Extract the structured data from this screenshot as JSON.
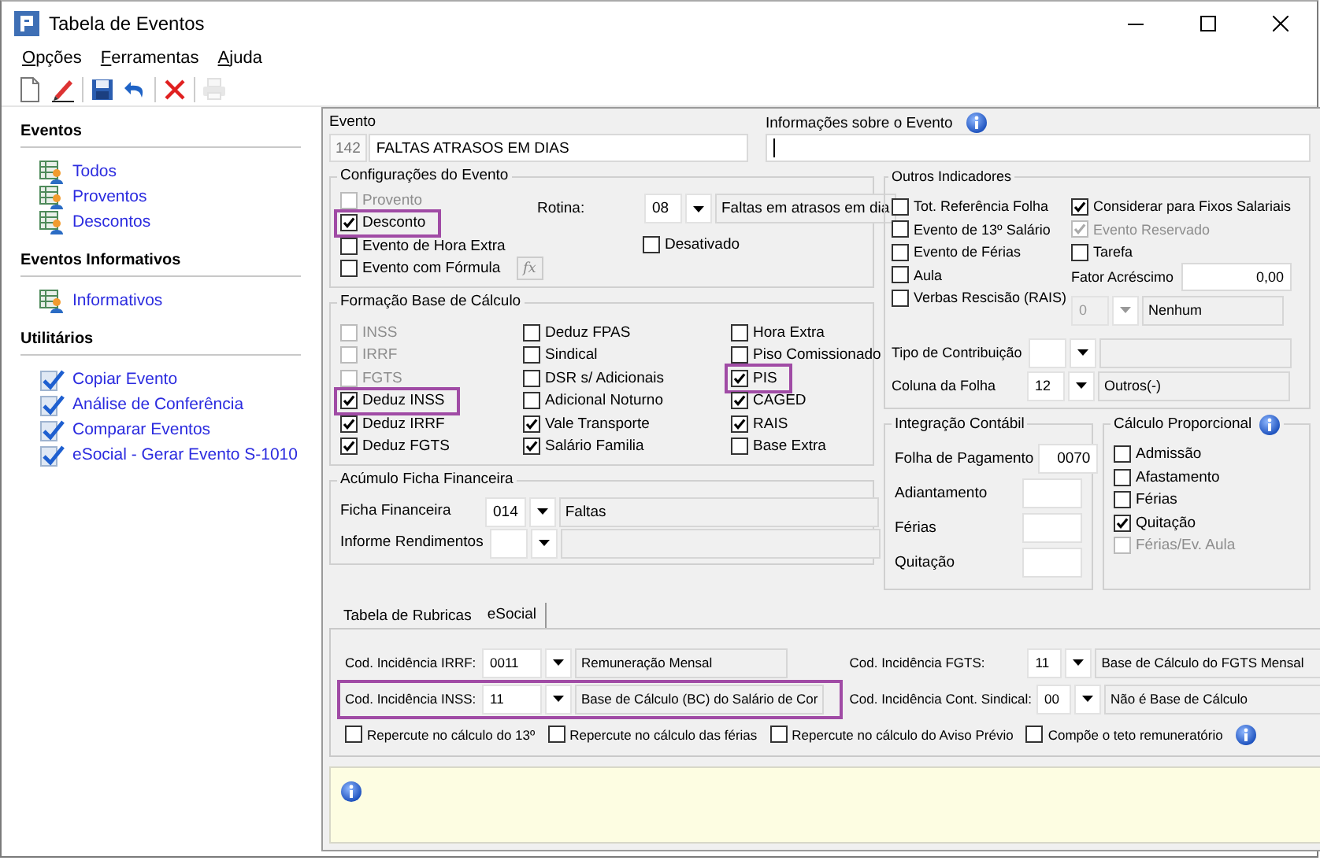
{
  "window": {
    "title": "Tabela de Eventos"
  },
  "menu": [
    {
      "label": "Opções"
    },
    {
      "label": "Ferramentas"
    },
    {
      "label": "Ajuda"
    }
  ],
  "toolbar": [
    {
      "kind": "new",
      "disabled": false
    },
    {
      "kind": "edit",
      "disabled": false
    },
    {
      "kind": "separator"
    },
    {
      "kind": "save",
      "disabled": false
    },
    {
      "kind": "undo",
      "disabled": false
    },
    {
      "kind": "separator"
    },
    {
      "kind": "delete",
      "disabled": false
    },
    {
      "kind": "separator"
    },
    {
      "kind": "print",
      "disabled": true
    }
  ],
  "sidebar": [
    {
      "title": "Eventos",
      "items": [
        {
          "label": "Todos",
          "kind": "list"
        },
        {
          "label": "Proventos",
          "kind": "list"
        },
        {
          "label": "Descontos",
          "kind": "list"
        }
      ]
    },
    {
      "title": "Eventos Informativos",
      "items": [
        {
          "label": "Informativos",
          "kind": "list"
        }
      ]
    },
    {
      "title": "Utilitários",
      "items": [
        {
          "label": "Copiar Evento",
          "kind": "tool"
        },
        {
          "label": "Análise de Conferência",
          "kind": "tool"
        },
        {
          "label": "Comparar Eventos",
          "kind": "tool"
        },
        {
          "label": "eSocial - Gerar Evento S-1010",
          "kind": "tool"
        }
      ]
    }
  ],
  "evento": {
    "label": "Evento",
    "code": "142",
    "name": "FALTAS ATRASOS EM DIAS"
  },
  "informacoes": {
    "label": "Informações sobre o Evento"
  },
  "configuracoes": {
    "title": "Configurações do Evento",
    "checkboxes": [
      {
        "label": "Provento",
        "checked": false,
        "disabled": true,
        "highlighted": false
      },
      {
        "label": "Desconto",
        "checked": true,
        "disabled": false,
        "highlighted": true
      },
      {
        "label": "Evento de Hora Extra",
        "checked": false,
        "disabled": false,
        "highlighted": false
      },
      {
        "label": "Evento com Fórmula",
        "checked": false,
        "disabled": false,
        "highlighted": false,
        "button": "fx"
      }
    ],
    "rotina": {
      "label": "Rotina:",
      "code": "08",
      "description": "Faltas em atrasos em dia"
    },
    "desativado": {
      "label": "Desativado",
      "checked": false
    }
  },
  "formacao": {
    "title": "Formação Base de Cálculo",
    "checkboxes": [
      {
        "label": "INSS",
        "checked": false,
        "disabled": true,
        "highlighted": false
      },
      {
        "label": "IRRF",
        "checked": false,
        "disabled": true,
        "highlighted": false
      },
      {
        "label": "FGTS",
        "checked": false,
        "disabled": true,
        "highlighted": false
      },
      {
        "label": "Deduz INSS",
        "checked": true,
        "disabled": false,
        "highlighted": true
      },
      {
        "label": "Deduz IRRF",
        "checked": true,
        "disabled": false,
        "highlighted": false
      },
      {
        "label": "Deduz FGTS",
        "checked": true,
        "disabled": false,
        "highlighted": false
      },
      {
        "label": "Deduz FPAS",
        "checked": false,
        "disabled": false,
        "highlighted": false
      },
      {
        "label": "Sindical",
        "checked": false,
        "disabled": false,
        "highlighted": false
      },
      {
        "label": "DSR s/ Adicionais",
        "checked": false,
        "disabled": false,
        "highlighted": false
      },
      {
        "label": "Adicional Noturno",
        "checked": false,
        "disabled": false,
        "highlighted": false
      },
      {
        "label": "Vale Transporte",
        "checked": true,
        "disabled": false,
        "highlighted": false
      },
      {
        "label": "Salário Familia",
        "checked": true,
        "disabled": false,
        "highlighted": false
      },
      {
        "label": "Hora Extra",
        "checked": false,
        "disabled": false,
        "highlighted": false
      },
      {
        "label": "Piso Comissionado",
        "checked": false,
        "disabled": false,
        "highlighted": false
      },
      {
        "label": "PIS",
        "checked": true,
        "disabled": false,
        "highlighted": true
      },
      {
        "label": "CAGED",
        "checked": true,
        "disabled": false,
        "highlighted": false
      },
      {
        "label": "RAIS",
        "checked": true,
        "disabled": false,
        "highlighted": false
      },
      {
        "label": "Base Extra",
        "checked": false,
        "disabled": false,
        "highlighted": false
      }
    ]
  },
  "acumulo": {
    "title": "Acúmulo Ficha Financeira",
    "rows": [
      {
        "label": "Ficha Financeira",
        "code": "014",
        "description": "Faltas"
      },
      {
        "label": "Informe Rendimentos"
      }
    ]
  },
  "outros": {
    "title": "Outros Indicadores",
    "left": [
      {
        "label": "Tot. Referência Folha",
        "checked": false
      },
      {
        "label": "Evento de 13º Salário",
        "checked": false
      },
      {
        "label": "Evento de Férias",
        "checked": false
      },
      {
        "label": "Aula",
        "checked": false
      },
      {
        "label": "Verbas Rescisão (RAIS)",
        "checked": false
      }
    ],
    "right": [
      {
        "label": "Considerar para Fixos Salariais",
        "checked": true,
        "disabled": false
      },
      {
        "label": "Evento Reservado",
        "checked": true,
        "disabled": true
      },
      {
        "label": "Tarefa",
        "checked": false,
        "disabled": false
      }
    ],
    "fator": {
      "label": "Fator Acréscimo",
      "value": "0,00"
    },
    "verbas_combo": {
      "code": "0",
      "description": "Nenhum",
      "disabled": true
    },
    "rows": [
      {
        "label": "Tipo de Contribuição"
      },
      {
        "label": "Coluna da Folha",
        "code": "12",
        "description": "Outros(-)"
      }
    ]
  },
  "integracao": {
    "title": "Integração Contábil",
    "rows": [
      {
        "label": "Folha de Pagamento",
        "value": "0070"
      },
      {
        "label": "Adiantamento"
      },
      {
        "label": "Férias"
      },
      {
        "label": "Quitação"
      }
    ]
  },
  "calculo": {
    "title": "Cálculo Proporcional",
    "checkboxes": [
      {
        "label": "Admissão",
        "checked": false,
        "disabled": false
      },
      {
        "label": "Afastamento",
        "checked": false,
        "disabled": false
      },
      {
        "label": "Férias",
        "checked": false,
        "disabled": false
      },
      {
        "label": "Quitação",
        "checked": true,
        "disabled": false
      },
      {
        "label": "Férias/Ev. Aula",
        "checked": false,
        "disabled": true
      }
    ]
  },
  "tabs": [
    {
      "label": "Tabela de Rubricas",
      "selected": false
    },
    {
      "label": "eSocial",
      "selected": true
    }
  ],
  "esocial": {
    "fields": [
      {
        "label": "Cod. Incidência IRRF:",
        "code": "0011",
        "description": "Remuneração Mensal",
        "highlighted": false
      },
      {
        "label": "Cod. Incidência FGTS:",
        "code": "11",
        "description": "Base de Cálculo do FGTS Mensal",
        "highlighted": false
      },
      {
        "label": "Cod. Incidência INSS:",
        "code": "11",
        "description": "Base de Cálculo (BC) do Salário de Cor",
        "highlighted": true
      },
      {
        "label": "Cod. Incidência Cont. Sindical:",
        "code": "00",
        "description": "Não é Base de Cálculo",
        "highlighted": false
      }
    ],
    "checkboxes": [
      {
        "label": "Repercute no cálculo do 13º",
        "checked": false
      },
      {
        "label": "Repercute no cálculo das férias",
        "checked": false
      },
      {
        "label": "Repercute no cálculo do Aviso Prévio",
        "checked": false
      },
      {
        "label": "Compõe o teto remuneratório",
        "checked": false
      }
    ]
  }
}
